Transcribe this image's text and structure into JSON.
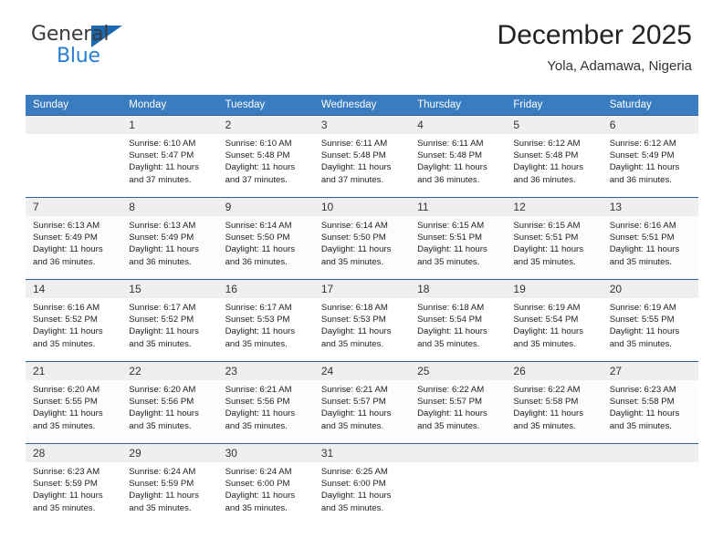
{
  "brand": {
    "name_part1": "General",
    "name_part2": "Blue",
    "triangle_color": "#1b68b3",
    "blue_color": "#2980d0"
  },
  "header": {
    "title": "December 2025",
    "subtitle": "Yola, Adamawa, Nigeria"
  },
  "theme": {
    "header_blue": "#3a7cc0",
    "row_divider": "#2f5f94",
    "daynum_band": "#efefef"
  },
  "weekday_headers": [
    "Sunday",
    "Monday",
    "Tuesday",
    "Wednesday",
    "Thursday",
    "Friday",
    "Saturday"
  ],
  "weeks": [
    [
      {
        "day": "",
        "sunrise": "",
        "sunset": "",
        "daylight1": "",
        "daylight2": ""
      },
      {
        "day": "1",
        "sunrise": "Sunrise: 6:10 AM",
        "sunset": "Sunset: 5:47 PM",
        "daylight1": "Daylight: 11 hours",
        "daylight2": "and 37 minutes."
      },
      {
        "day": "2",
        "sunrise": "Sunrise: 6:10 AM",
        "sunset": "Sunset: 5:48 PM",
        "daylight1": "Daylight: 11 hours",
        "daylight2": "and 37 minutes."
      },
      {
        "day": "3",
        "sunrise": "Sunrise: 6:11 AM",
        "sunset": "Sunset: 5:48 PM",
        "daylight1": "Daylight: 11 hours",
        "daylight2": "and 37 minutes."
      },
      {
        "day": "4",
        "sunrise": "Sunrise: 6:11 AM",
        "sunset": "Sunset: 5:48 PM",
        "daylight1": "Daylight: 11 hours",
        "daylight2": "and 36 minutes."
      },
      {
        "day": "5",
        "sunrise": "Sunrise: 6:12 AM",
        "sunset": "Sunset: 5:48 PM",
        "daylight1": "Daylight: 11 hours",
        "daylight2": "and 36 minutes."
      },
      {
        "day": "6",
        "sunrise": "Sunrise: 6:12 AM",
        "sunset": "Sunset: 5:49 PM",
        "daylight1": "Daylight: 11 hours",
        "daylight2": "and 36 minutes."
      }
    ],
    [
      {
        "day": "7",
        "sunrise": "Sunrise: 6:13 AM",
        "sunset": "Sunset: 5:49 PM",
        "daylight1": "Daylight: 11 hours",
        "daylight2": "and 36 minutes."
      },
      {
        "day": "8",
        "sunrise": "Sunrise: 6:13 AM",
        "sunset": "Sunset: 5:49 PM",
        "daylight1": "Daylight: 11 hours",
        "daylight2": "and 36 minutes."
      },
      {
        "day": "9",
        "sunrise": "Sunrise: 6:14 AM",
        "sunset": "Sunset: 5:50 PM",
        "daylight1": "Daylight: 11 hours",
        "daylight2": "and 36 minutes."
      },
      {
        "day": "10",
        "sunrise": "Sunrise: 6:14 AM",
        "sunset": "Sunset: 5:50 PM",
        "daylight1": "Daylight: 11 hours",
        "daylight2": "and 35 minutes."
      },
      {
        "day": "11",
        "sunrise": "Sunrise: 6:15 AM",
        "sunset": "Sunset: 5:51 PM",
        "daylight1": "Daylight: 11 hours",
        "daylight2": "and 35 minutes."
      },
      {
        "day": "12",
        "sunrise": "Sunrise: 6:15 AM",
        "sunset": "Sunset: 5:51 PM",
        "daylight1": "Daylight: 11 hours",
        "daylight2": "and 35 minutes."
      },
      {
        "day": "13",
        "sunrise": "Sunrise: 6:16 AM",
        "sunset": "Sunset: 5:51 PM",
        "daylight1": "Daylight: 11 hours",
        "daylight2": "and 35 minutes."
      }
    ],
    [
      {
        "day": "14",
        "sunrise": "Sunrise: 6:16 AM",
        "sunset": "Sunset: 5:52 PM",
        "daylight1": "Daylight: 11 hours",
        "daylight2": "and 35 minutes."
      },
      {
        "day": "15",
        "sunrise": "Sunrise: 6:17 AM",
        "sunset": "Sunset: 5:52 PM",
        "daylight1": "Daylight: 11 hours",
        "daylight2": "and 35 minutes."
      },
      {
        "day": "16",
        "sunrise": "Sunrise: 6:17 AM",
        "sunset": "Sunset: 5:53 PM",
        "daylight1": "Daylight: 11 hours",
        "daylight2": "and 35 minutes."
      },
      {
        "day": "17",
        "sunrise": "Sunrise: 6:18 AM",
        "sunset": "Sunset: 5:53 PM",
        "daylight1": "Daylight: 11 hours",
        "daylight2": "and 35 minutes."
      },
      {
        "day": "18",
        "sunrise": "Sunrise: 6:18 AM",
        "sunset": "Sunset: 5:54 PM",
        "daylight1": "Daylight: 11 hours",
        "daylight2": "and 35 minutes."
      },
      {
        "day": "19",
        "sunrise": "Sunrise: 6:19 AM",
        "sunset": "Sunset: 5:54 PM",
        "daylight1": "Daylight: 11 hours",
        "daylight2": "and 35 minutes."
      },
      {
        "day": "20",
        "sunrise": "Sunrise: 6:19 AM",
        "sunset": "Sunset: 5:55 PM",
        "daylight1": "Daylight: 11 hours",
        "daylight2": "and 35 minutes."
      }
    ],
    [
      {
        "day": "21",
        "sunrise": "Sunrise: 6:20 AM",
        "sunset": "Sunset: 5:55 PM",
        "daylight1": "Daylight: 11 hours",
        "daylight2": "and 35 minutes."
      },
      {
        "day": "22",
        "sunrise": "Sunrise: 6:20 AM",
        "sunset": "Sunset: 5:56 PM",
        "daylight1": "Daylight: 11 hours",
        "daylight2": "and 35 minutes."
      },
      {
        "day": "23",
        "sunrise": "Sunrise: 6:21 AM",
        "sunset": "Sunset: 5:56 PM",
        "daylight1": "Daylight: 11 hours",
        "daylight2": "and 35 minutes."
      },
      {
        "day": "24",
        "sunrise": "Sunrise: 6:21 AM",
        "sunset": "Sunset: 5:57 PM",
        "daylight1": "Daylight: 11 hours",
        "daylight2": "and 35 minutes."
      },
      {
        "day": "25",
        "sunrise": "Sunrise: 6:22 AM",
        "sunset": "Sunset: 5:57 PM",
        "daylight1": "Daylight: 11 hours",
        "daylight2": "and 35 minutes."
      },
      {
        "day": "26",
        "sunrise": "Sunrise: 6:22 AM",
        "sunset": "Sunset: 5:58 PM",
        "daylight1": "Daylight: 11 hours",
        "daylight2": "and 35 minutes."
      },
      {
        "day": "27",
        "sunrise": "Sunrise: 6:23 AM",
        "sunset": "Sunset: 5:58 PM",
        "daylight1": "Daylight: 11 hours",
        "daylight2": "and 35 minutes."
      }
    ],
    [
      {
        "day": "28",
        "sunrise": "Sunrise: 6:23 AM",
        "sunset": "Sunset: 5:59 PM",
        "daylight1": "Daylight: 11 hours",
        "daylight2": "and 35 minutes."
      },
      {
        "day": "29",
        "sunrise": "Sunrise: 6:24 AM",
        "sunset": "Sunset: 5:59 PM",
        "daylight1": "Daylight: 11 hours",
        "daylight2": "and 35 minutes."
      },
      {
        "day": "30",
        "sunrise": "Sunrise: 6:24 AM",
        "sunset": "Sunset: 6:00 PM",
        "daylight1": "Daylight: 11 hours",
        "daylight2": "and 35 minutes."
      },
      {
        "day": "31",
        "sunrise": "Sunrise: 6:25 AM",
        "sunset": "Sunset: 6:00 PM",
        "daylight1": "Daylight: 11 hours",
        "daylight2": "and 35 minutes."
      },
      {
        "day": "",
        "sunrise": "",
        "sunset": "",
        "daylight1": "",
        "daylight2": ""
      },
      {
        "day": "",
        "sunrise": "",
        "sunset": "",
        "daylight1": "",
        "daylight2": ""
      },
      {
        "day": "",
        "sunrise": "",
        "sunset": "",
        "daylight1": "",
        "daylight2": ""
      }
    ]
  ]
}
